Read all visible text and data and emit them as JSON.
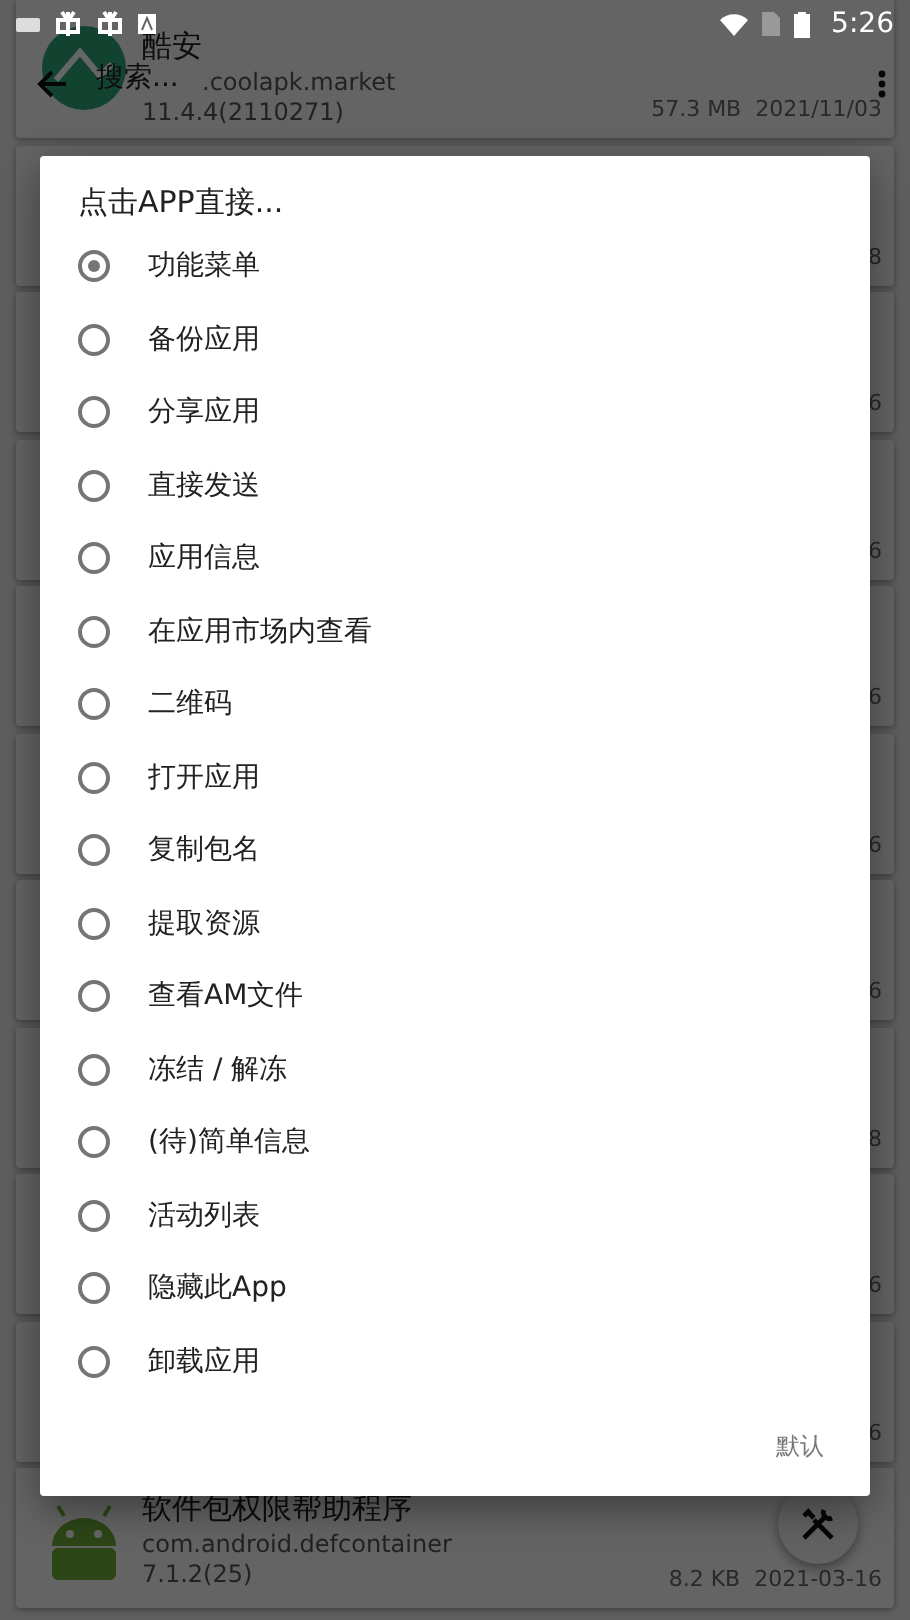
{
  "status_bar": {
    "time": "5:26"
  },
  "app_bar": {
    "placeholder": "搜索..."
  },
  "apps": [
    {
      "kind": "full",
      "name": "酷安",
      "package": ".coolapk.market",
      "version": "11.4.4(2110271)",
      "size_date": "57.3 MB  2021/11/03"
    },
    {
      "kind": "edge",
      "size_date": "8"
    },
    {
      "kind": "edge",
      "size_date": "6"
    },
    {
      "kind": "edge",
      "size_date": "6"
    },
    {
      "kind": "edge",
      "size_date": "6"
    },
    {
      "kind": "edge",
      "size_date": "6"
    },
    {
      "kind": "edge",
      "size_date": "6"
    },
    {
      "kind": "edge",
      "size_date": "8"
    },
    {
      "kind": "edge",
      "size_date": "6"
    },
    {
      "kind": "edge",
      "size_date": "6"
    },
    {
      "kind": "full",
      "name": "软件包权限帮助程序",
      "package": "com.android.defcontainer",
      "version": "7.1.2(25)",
      "size_date": "8.2 KB  2021-03-16"
    }
  ],
  "dialog": {
    "title": "点击APP直接...",
    "options": [
      {
        "label": "功能菜单",
        "selected": true
      },
      {
        "label": "备份应用",
        "selected": false
      },
      {
        "label": "分享应用",
        "selected": false
      },
      {
        "label": "直接发送",
        "selected": false
      },
      {
        "label": "应用信息",
        "selected": false
      },
      {
        "label": "在应用市场内查看",
        "selected": false
      },
      {
        "label": "二维码",
        "selected": false
      },
      {
        "label": "打开应用",
        "selected": false
      },
      {
        "label": "复制包名",
        "selected": false
      },
      {
        "label": "提取资源",
        "selected": false
      },
      {
        "label": "查看AM文件",
        "selected": false
      },
      {
        "label": "冻结 / 解冻",
        "selected": false
      },
      {
        "label": "(待)简单信息",
        "selected": false
      },
      {
        "label": "活动列表",
        "selected": false
      },
      {
        "label": "隐藏此App",
        "selected": false
      },
      {
        "label": "卸载应用",
        "selected": false
      }
    ],
    "button": "默认"
  }
}
